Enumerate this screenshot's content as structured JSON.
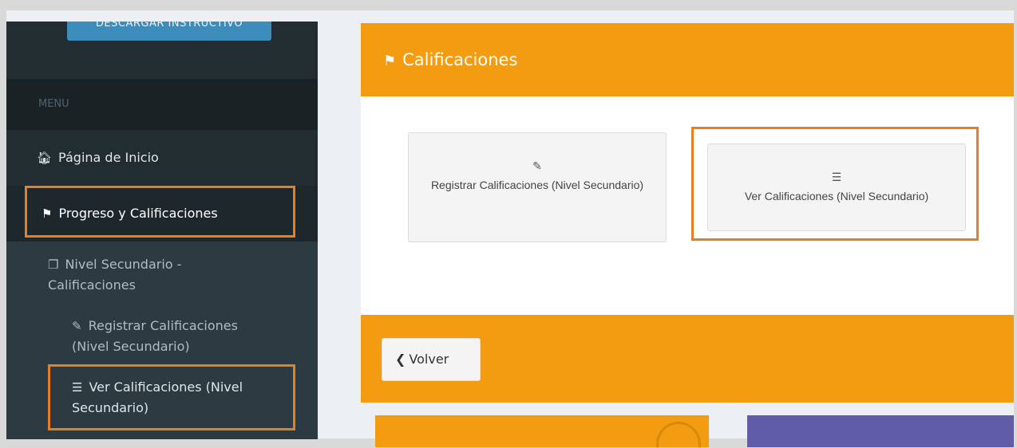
{
  "sidebar": {
    "download_button": "DESCARGAR INSTRUCTIVO",
    "menu_header": "MENU",
    "items": [
      {
        "label": "Página de Inicio",
        "icon": "home-icon"
      },
      {
        "label": "Progreso y Calificaciones",
        "icon": "flag-checkered-icon"
      },
      {
        "label": "Nivel Secundario - Calificaciones",
        "icon": "copy-icon"
      },
      {
        "label": "Registrar Calificaciones (Nivel Secundario)",
        "icon": "edit-icon"
      },
      {
        "label": "Ver Calificaciones (Nivel Secundario)",
        "icon": "list-ol-icon"
      }
    ]
  },
  "content": {
    "title": "Calificaciones",
    "tiles": [
      {
        "label": "Registrar Calificaciones (Nivel Secundario)",
        "icon": "edit-icon"
      },
      {
        "label": "Ver Calificaciones (Nivel Secundario)",
        "icon": "list-ol-icon"
      }
    ],
    "back_button": "Volver"
  },
  "colors": {
    "sidebar_bg": "#222d32",
    "header_orange": "#f39c12",
    "highlight_orange": "#e67e22",
    "card_purple": "#605ca8",
    "download_blue": "#3c8dbc"
  }
}
